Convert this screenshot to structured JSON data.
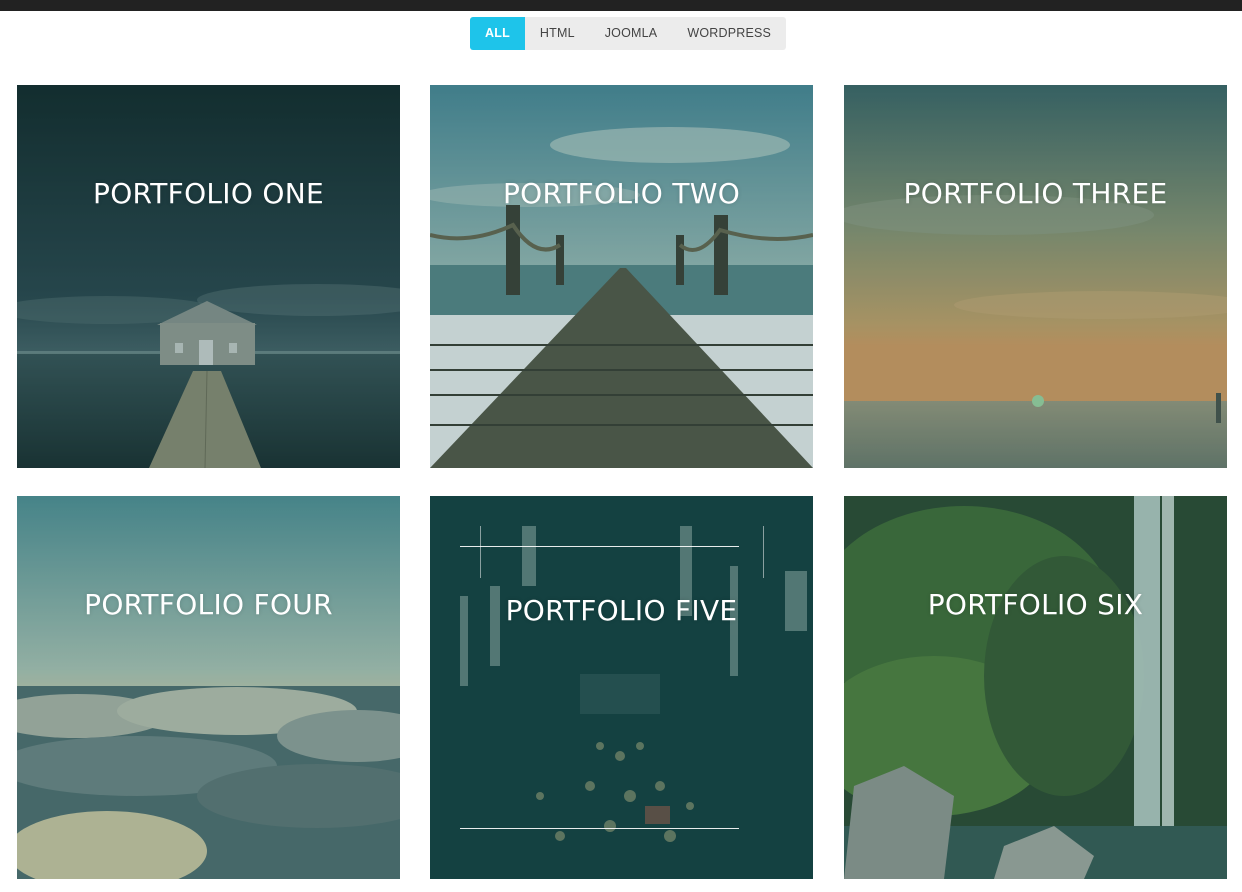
{
  "filters": [
    {
      "label": "ALL",
      "active": true
    },
    {
      "label": "HTML",
      "active": false
    },
    {
      "label": "JOOMLA",
      "active": false
    },
    {
      "label": "WORDPRESS",
      "active": false
    }
  ],
  "portfolio": [
    {
      "title": "PORTFOLIO ONE",
      "icon": "boathouse-pier-image"
    },
    {
      "title": "PORTFOLIO TWO",
      "icon": "wooden-pier-image"
    },
    {
      "title": "PORTFOLIO THREE",
      "icon": "sea-sunset-image"
    },
    {
      "title": "PORTFOLIO FOUR",
      "icon": "clouds-image"
    },
    {
      "title": "PORTFOLIO FIVE",
      "icon": "city-lights-image"
    },
    {
      "title": "PORTFOLIO SIX",
      "icon": "waterfall-image"
    }
  ],
  "colors": {
    "accent": "#1ec4ea",
    "topbar": "#222222",
    "overlay": "#1a5a55"
  }
}
